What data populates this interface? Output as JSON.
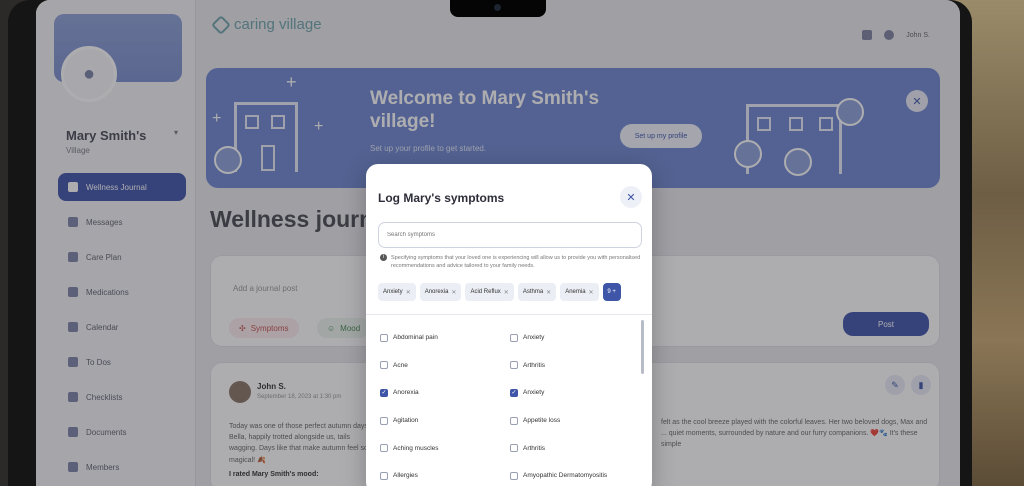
{
  "app": {
    "logo_text": "caring village",
    "user_name": "John S."
  },
  "sidebar": {
    "village_name": "Mary Smith's",
    "village_label": "Village",
    "items": [
      {
        "label": "Wellness Journal",
        "active": true
      },
      {
        "label": "Messages"
      },
      {
        "label": "Care Plan"
      },
      {
        "label": "Medications"
      },
      {
        "label": "Calendar"
      },
      {
        "label": "To Dos"
      },
      {
        "label": "Checklists"
      },
      {
        "label": "Documents"
      },
      {
        "label": "Members"
      }
    ]
  },
  "banner": {
    "title": "Welcome to Mary Smith's village!",
    "subtitle": "Set up your profile to get started.",
    "button_label": "Set up my profile"
  },
  "journal": {
    "title": "Wellness journal",
    "input_placeholder": "Add a journal post",
    "symptoms_chip": "Symptoms",
    "mood_chip": "Mood",
    "post_button": "Post"
  },
  "entry": {
    "author": "John S.",
    "date": "September 18, 2023 at 1:30 pm",
    "text_left": "Today was one of those perfect autumn days. Bella, happily trotted alongside us, tails wagging. Days like that make autumn feel so magical! 🍂",
    "text_right": "felt as the cool breeze played with the colorful leaves. Her two beloved dogs, Max and ... quiet moments, surrounded by nature and our furry companions. ❤️🐾 It's these simple",
    "mood_line": "I rated Mary Smith's mood:"
  },
  "modal": {
    "title": "Log Mary's symptoms",
    "search_placeholder": "Search symptoms",
    "info": "Specifying symptoms that your loved one is experiencing will allow us to provide you with personalised recommendations and advice tailored to your family needs.",
    "selected_tags": [
      "Anxiety",
      "Anorexia",
      "Acid Reflux",
      "Asthma",
      "Anemia"
    ],
    "more_count": "9 +",
    "symptoms": [
      {
        "label": "Abdominal pain",
        "checked": false
      },
      {
        "label": "Anxiety",
        "checked": false
      },
      {
        "label": "Acne",
        "checked": false
      },
      {
        "label": "Arthritis",
        "checked": false
      },
      {
        "label": "Anorexia",
        "checked": true
      },
      {
        "label": "Anxiety",
        "checked": true
      },
      {
        "label": "Agitation",
        "checked": false
      },
      {
        "label": "Appetite loss",
        "checked": false
      },
      {
        "label": "Aching muscles",
        "checked": false
      },
      {
        "label": "Arthritis",
        "checked": false
      },
      {
        "label": "Allergies",
        "checked": false
      },
      {
        "label": "Amyopathic Dermatomyositis",
        "checked": false
      }
    ]
  },
  "colors": {
    "accent": "#3f55a8",
    "banner": "#6f86cf",
    "logo": "#6fa3a8"
  }
}
